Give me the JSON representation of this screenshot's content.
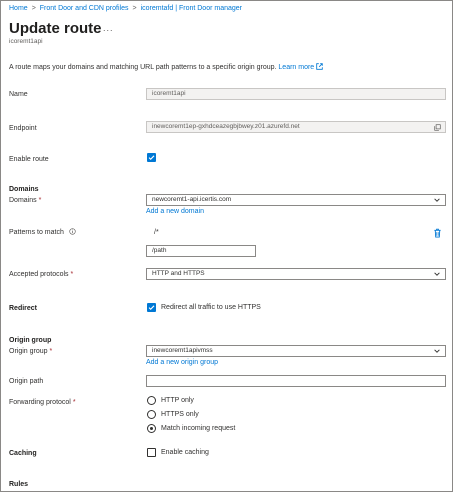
{
  "breadcrumb": {
    "items": [
      "Home",
      "Front Door and CDN profiles",
      "icoremtafd | Front Door manager"
    ],
    "separator": ">"
  },
  "header": {
    "title": "Update route",
    "more": "...",
    "subtitle": "icoremt1api"
  },
  "description": {
    "text": "A route maps your domains and matching URL path patterns to a specific origin group.",
    "learn_more": "Learn more"
  },
  "form": {
    "name": {
      "label": "Name",
      "value": "icoremt1api"
    },
    "endpoint": {
      "label": "Endpoint",
      "value": "inewcoremt1ep-gxhdceazegbjbwey.z01.azurefd.net"
    },
    "enable_route": {
      "label": "Enable route",
      "checked": true
    },
    "domains_section": "Domains",
    "domains": {
      "label": "Domains",
      "required": "*",
      "value": "newcoremt1-api.icertis.com",
      "add_link": "Add a new domain"
    },
    "patterns": {
      "label": "Patterns to match",
      "pattern_static": "/*",
      "pattern_input": "/path"
    },
    "protocols": {
      "label": "Accepted protocols",
      "required": "*",
      "value": "HTTP and HTTPS"
    },
    "redirect": {
      "label": "Redirect",
      "checkbox_label": "Redirect all traffic to use HTTPS",
      "checked": true
    },
    "origin_section": "Origin group",
    "origin_group": {
      "label": "Origin group",
      "required": "*",
      "value": "inewcoremt1apivmss",
      "add_link": "Add a new origin group"
    },
    "origin_path": {
      "label": "Origin path",
      "value": ""
    },
    "forwarding": {
      "label": "Forwarding protocol",
      "required": "*",
      "options": [
        "HTTP only",
        "HTTPS only",
        "Match incoming request"
      ],
      "selected": "Match incoming request"
    },
    "caching": {
      "label": "Caching",
      "checkbox_label": "Enable caching",
      "checked": false
    },
    "rules_section": "Rules"
  },
  "colors": {
    "accent": "#0078d4",
    "required": "#a4262c",
    "text": "#323130"
  }
}
